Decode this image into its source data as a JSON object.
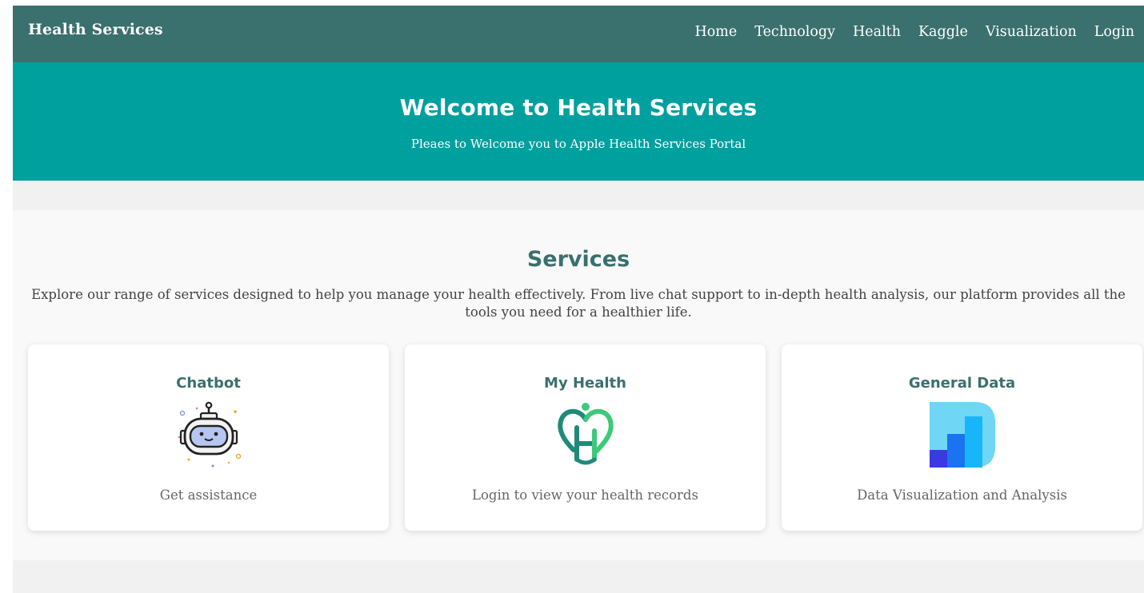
{
  "header": {
    "brand": "Health Services",
    "nav": [
      {
        "label": "Home"
      },
      {
        "label": "Technology"
      },
      {
        "label": "Health"
      },
      {
        "label": "Kaggle"
      },
      {
        "label": "Visualization"
      },
      {
        "label": "Login"
      }
    ]
  },
  "hero": {
    "title": "Welcome to Health Services",
    "subtitle": "Pleaes to Welcome you to Apple Health Services Portal"
  },
  "services": {
    "title": "Services",
    "intro": "Explore our range of services designed to help you manage your health effectively. From live chat support to in-depth health analysis, our platform provides all the tools you need for a healthier life.",
    "cards": [
      {
        "title": "Chatbot",
        "icon": "chatbot-robot-icon",
        "desc": "Get assistance"
      },
      {
        "title": "My Health",
        "icon": "heart-h-icon",
        "desc": "Login to view your health records"
      },
      {
        "title": "General Data",
        "icon": "data-chart-icon",
        "desc": "Data Visualization and Analysis"
      }
    ]
  },
  "colors": {
    "navbar": "#3a706e",
    "hero": "#00a09f",
    "heading": "#3a706e"
  }
}
